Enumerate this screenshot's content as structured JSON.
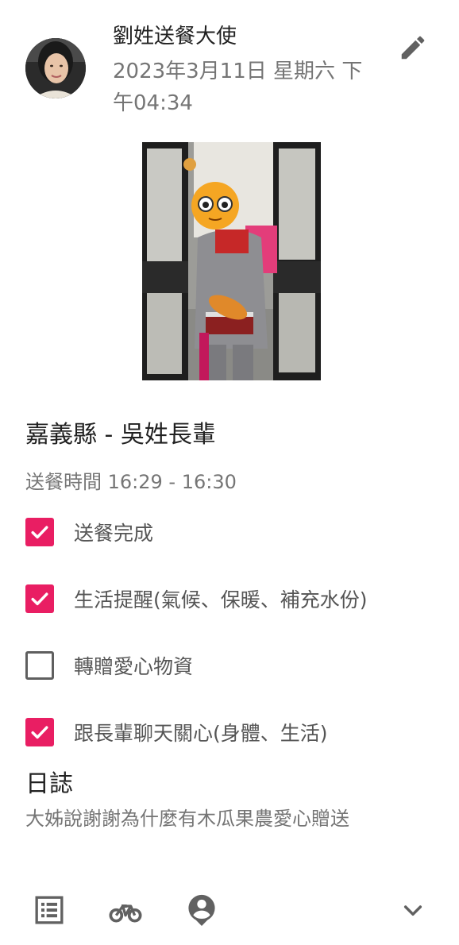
{
  "post": {
    "author": "劉姓送餐大使",
    "timestamp": "2023年3月11日 星期六 下午04:34",
    "title": "嘉義縣 - 吳姓長輩",
    "delivery_time_label": "送餐時間",
    "delivery_time_value": "16:29 - 16:30"
  },
  "checklist": [
    {
      "label": "送餐完成",
      "checked": true
    },
    {
      "label": "生活提醒(氣候、保暖、補充水份)",
      "checked": true
    },
    {
      "label": "轉贈愛心物資",
      "checked": false
    },
    {
      "label": "跟長輩聊天關心(身體、生活)",
      "checked": true
    }
  ],
  "log": {
    "heading": "日誌",
    "text": "大姊說謝謝為什麼有木瓜果農愛心贈送"
  },
  "icons": {
    "edit": "pencil-icon",
    "list": "list-icon",
    "bike": "bicycle-icon",
    "account": "account-pin-icon",
    "expand": "chevron-down-icon"
  },
  "colors": {
    "accent": "#e91e63",
    "icon": "#616161",
    "secondary_text": "#757575"
  }
}
